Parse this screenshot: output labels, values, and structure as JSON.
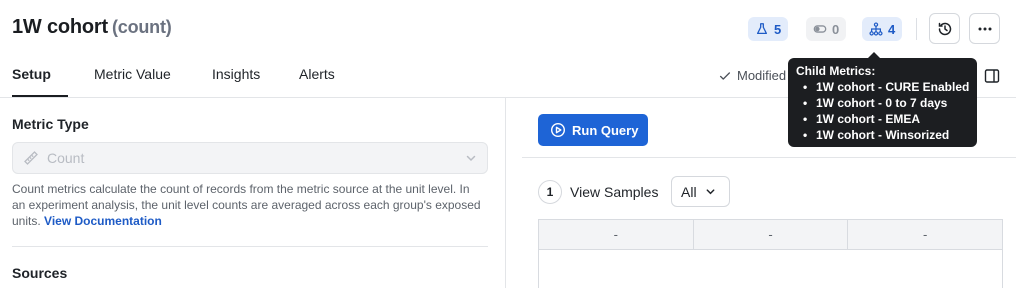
{
  "header": {
    "title": "1W cohort",
    "title_suffix": "(count)",
    "badges": {
      "experiments_count": "5",
      "toggle_count": "0",
      "child_metrics_count": "4"
    }
  },
  "tabs": [
    {
      "label": "Setup",
      "active": true
    },
    {
      "label": "Metric Value",
      "active": false
    },
    {
      "label": "Insights",
      "active": false
    },
    {
      "label": "Alerts",
      "active": false
    }
  ],
  "status": {
    "modified_label": "Modified"
  },
  "tooltip": {
    "title": "Child Metrics:",
    "items": [
      "1W cohort - CURE Enabled",
      "1W cohort - 0 to 7 days",
      "1W cohort - EMEA",
      "1W cohort - Winsorized"
    ]
  },
  "left_panel": {
    "metric_type_label": "Metric Type",
    "metric_type_value": "Count",
    "description": "Count metrics calculate the count of records from the metric source at the unit level. In an experiment analysis, the unit level counts are averaged across each group's exposed units.",
    "doc_link": "View Documentation",
    "sources_label": "Sources"
  },
  "right_panel": {
    "run_query_label": "Run Query",
    "step_number": "1",
    "view_samples_label": "View Samples",
    "samples_filter_value": "All",
    "table_headers": [
      "-",
      "-",
      "-"
    ]
  },
  "colors": {
    "accent": "#1e64d6",
    "badge_blue_bg": "#e3ecfb",
    "badge_blue_text": "#1e5bc6",
    "tooltip_bg": "#1c1e21"
  },
  "icons": {
    "experiments": "flask-icon",
    "toggle": "toggle-icon",
    "child_metrics": "hierarchy-icon",
    "history": "history-icon",
    "more": "more-horizontal-icon",
    "modified": "check-icon",
    "panel": "side-panel-icon",
    "metric_type": "ruler-icon",
    "run": "play-circle-icon"
  }
}
